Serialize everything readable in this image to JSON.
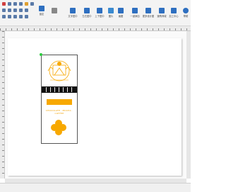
{
  "toolbar": {
    "items": [
      {
        "label": "",
        "icon": "new-icon"
      },
      {
        "label": "",
        "icon": "open-icon"
      },
      {
        "label": "",
        "icon": "save-icon"
      },
      {
        "label": "锁定",
        "icon": "lock-icon"
      },
      {
        "label": "",
        "icon": "align-icon"
      },
      {
        "label": "文字居中",
        "icon": "text-center-icon"
      },
      {
        "label": "左右居中",
        "icon": "h-center-icon"
      },
      {
        "label": "上下居中",
        "icon": "v-center-icon"
      },
      {
        "label": "图片",
        "icon": "image-icon"
      },
      {
        "label": "画图",
        "icon": "draw-icon"
      },
      {
        "label": "一键添加",
        "icon": "add-icon"
      },
      {
        "label": "更多设计图",
        "icon": "gallery-icon"
      },
      {
        "label": "速购商城",
        "icon": "cart-icon"
      },
      {
        "label": "加工中心",
        "icon": "factory-icon"
      },
      {
        "label": "帮助",
        "icon": "help-icon"
      }
    ],
    "accent": "#2e6fc0"
  },
  "label": {
    "bar_text": "",
    "slogan": "CHOCOLATE · MOCHA · COFFEE",
    "accent_color": "#f7a800"
  },
  "colors": {
    "toolbar_bg": "#f3f3f3",
    "canvas_bg": "#fafafa",
    "selection": "#2ecc40"
  }
}
